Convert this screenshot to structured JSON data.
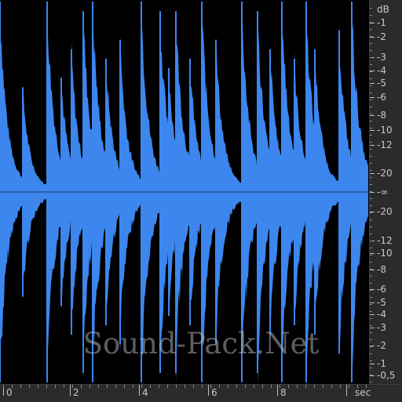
{
  "colors": {
    "waveform": "#3c86ee",
    "background": "#000000",
    "ruler": "#2b2b2b",
    "ruler_text": "#c8c8c8"
  },
  "db_axis": {
    "unit": "dB",
    "labels": [
      "-1",
      "-2",
      "-3",
      "-4",
      "-5",
      "-6",
      "-8",
      "-10",
      "-12",
      "-20",
      "-∞",
      "-20",
      "-12",
      "-10",
      "-8",
      "-6",
      "-5",
      "-4",
      "-3",
      "-2",
      "-1",
      "-0,5"
    ]
  },
  "time_axis": {
    "unit": "sec",
    "labels": [
      "0",
      "2",
      "4",
      "6",
      "8"
    ]
  },
  "waveform": {
    "description_free": true,
    "onset_times_sec": [
      0.0,
      0.65,
      1.35,
      1.75,
      2.05,
      2.4,
      2.65,
      3.05,
      3.45,
      4.05,
      4.6,
      4.85,
      5.05,
      5.45,
      5.8,
      6.2,
      6.95,
      7.4,
      7.75,
      8.1,
      8.45,
      8.8,
      9.05,
      9.75,
      10.1
    ],
    "onset_peaks": [
      1.0,
      0.55,
      1.0,
      0.6,
      0.75,
      0.95,
      1.0,
      0.7,
      0.8,
      1.0,
      0.95,
      0.65,
      0.95,
      0.7,
      1.0,
      0.8,
      1.0,
      0.95,
      0.75,
      1.0,
      0.7,
      1.0,
      0.75,
      0.85,
      1.0
    ],
    "duration_sec": 10.6
  },
  "watermark": "Sound-Pack.Net"
}
